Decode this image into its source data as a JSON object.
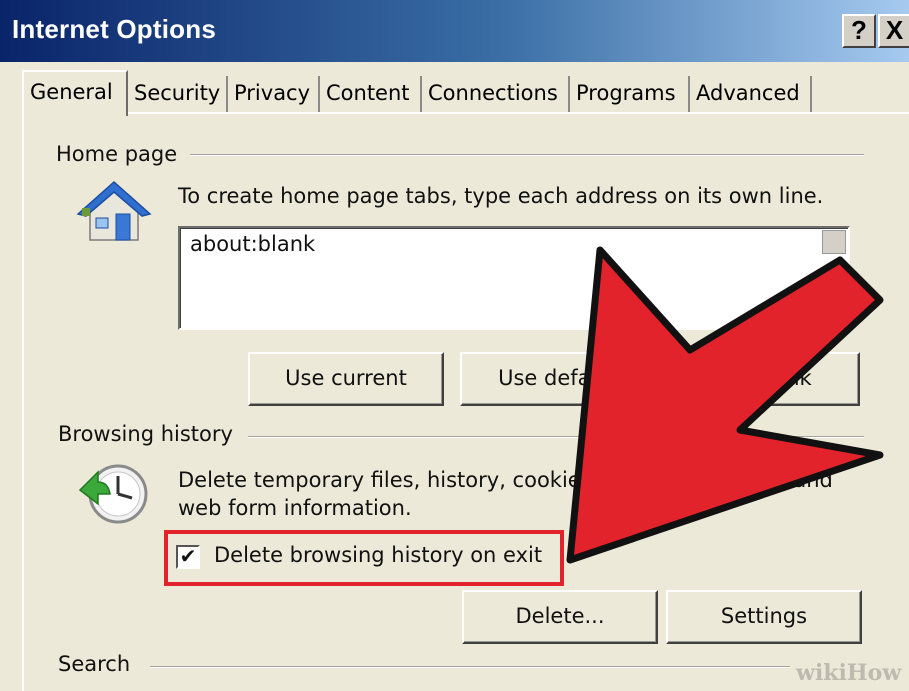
{
  "window": {
    "title": "Internet Options",
    "help_glyph": "?",
    "close_glyph": "X"
  },
  "tabs": [
    {
      "label": "General",
      "active": true
    },
    {
      "label": "Security"
    },
    {
      "label": "Privacy"
    },
    {
      "label": "Content"
    },
    {
      "label": "Connections"
    },
    {
      "label": "Programs"
    },
    {
      "label": "Advanced"
    }
  ],
  "home_page": {
    "section_label": "Home page",
    "icon": "house-icon",
    "description": "To create home page tabs, type each address on its own line.",
    "address_value": "about:blank",
    "buttons": {
      "use_current": "Use current",
      "use_default": "Use default",
      "use_blank_visible": "nk"
    }
  },
  "browsing_history": {
    "section_label": "Browsing history",
    "icon": "history-clock-icon",
    "description_line1": "Delete temporary files, history, cookies,",
    "description_line1_end": ", and",
    "description_line2": "web form information.",
    "checkbox_label": "Delete browsing history on exit",
    "checkbox_checked": true,
    "checkbox_glyph": "✔",
    "delete_button": "Delete...",
    "settings_button": "Settings"
  },
  "search": {
    "section_label": "Search"
  },
  "annotation": {
    "arrow_color": "#e3232c",
    "highlight_color": "#e3232c"
  },
  "watermark": "wikiHow"
}
